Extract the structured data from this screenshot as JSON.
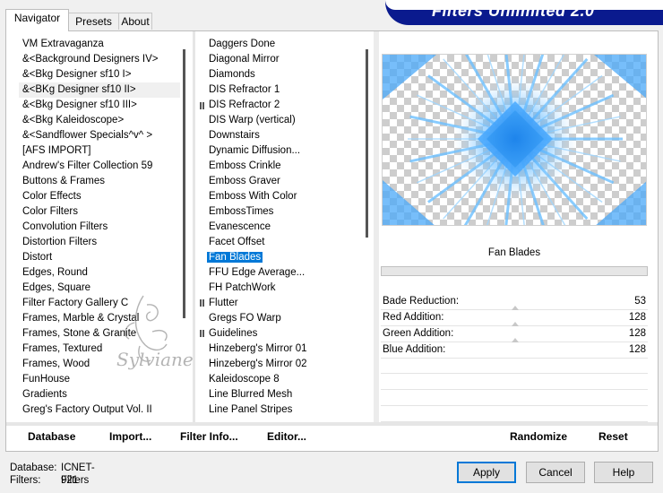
{
  "window": {
    "title": "Filters Unlimited 2.0"
  },
  "tabs": [
    "Navigator",
    "Presets",
    "About"
  ],
  "categories": [
    "VM Extravaganza",
    "&<Background Designers IV>",
    "&<Bkg Designer sf10 I>",
    "&<BKg Designer sf10 II>",
    "&<Bkg Designer sf10 III>",
    "&<Bkg Kaleidoscope>",
    "&<Sandflower Specials^v^ >",
    "[AFS IMPORT]",
    "Andrew's Filter Collection 59",
    "Buttons & Frames",
    "Color Effects",
    "Color Filters",
    "Convolution Filters",
    "Distortion Filters",
    "Distort",
    "Edges, Round",
    "Edges, Square",
    "Filter Factory Gallery C",
    "Frames, Marble & Crystal",
    "Frames, Stone & Granite",
    "Frames, Textured",
    "Frames, Wood",
    "FunHouse",
    "Gradients",
    "Greg's Factory Output Vol. II"
  ],
  "filters": [
    "Daggers Done",
    "Diagonal Mirror",
    "Diamonds",
    "DIS Refractor 1",
    "DIS Refractor 2",
    "DIS Warp (vertical)",
    "Downstairs",
    "Dynamic Diffusion...",
    "Emboss Crinkle",
    "Emboss Graver",
    "Emboss With Color",
    "EmbossTimes",
    "Evanescence",
    "Facet Offset",
    "Fan Blades",
    "FFU Edge Average...",
    "FH PatchWork",
    "Flutter",
    "Gregs FO Warp",
    "Guidelines",
    "Hinzeberg's Mirror 01",
    "Hinzeberg's Mirror 02",
    "Kaleidoscope 8",
    "Line Blurred Mesh",
    "Line Panel Stripes"
  ],
  "selected_filter": "Fan Blades",
  "parameters": [
    {
      "label": "Bade Reduction:",
      "value": "53"
    },
    {
      "label": "Red Addition:",
      "value": "128"
    },
    {
      "label": "Green Addition:",
      "value": "128"
    },
    {
      "label": "Blue Addition:",
      "value": "128"
    }
  ],
  "buttons": {
    "database": "Database",
    "import": "Import...",
    "filter_info": "Filter Info...",
    "editor": "Editor...",
    "randomize": "Randomize",
    "reset": "Reset",
    "apply": "Apply",
    "cancel": "Cancel",
    "help": "Help"
  },
  "status": {
    "database_label": "Database:",
    "database_value": "ICNET-Filters",
    "filters_label": "Filters:",
    "filters_value": "921"
  },
  "watermark_text": "Sylviane",
  "colors": {
    "banner": "#0a1a8e",
    "selection": "#0078d7",
    "preview_blue": "#3aa0ff"
  }
}
